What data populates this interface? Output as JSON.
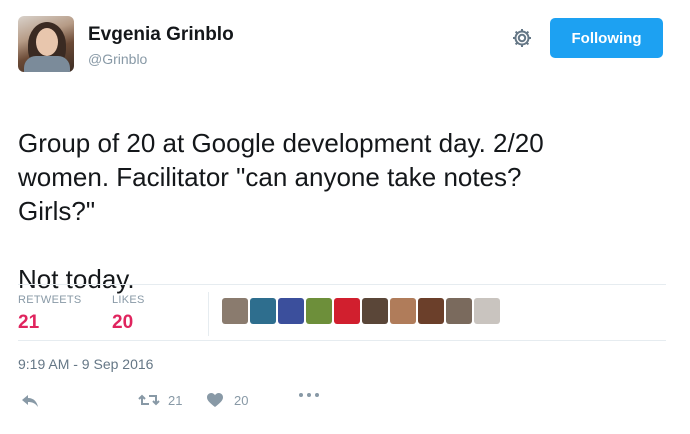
{
  "user": {
    "name": "Evgenia Grinblo",
    "handle": "@Grinblo"
  },
  "follow_button": {
    "label": "Following"
  },
  "tweet": {
    "line1": "Group of 20 at Google development day. 2/20\nwomen. Facilitator \"can anyone take notes?\nGirls?\"",
    "line2": "Not today."
  },
  "stats": {
    "retweets_label": "RETWEETS",
    "retweets": "21",
    "likes_label": "LIKES",
    "likes": "20"
  },
  "likers": [
    {
      "icon": "liker-avatar",
      "color": "#8a7b6e"
    },
    {
      "icon": "liker-avatar",
      "color": "#2e6e8e"
    },
    {
      "icon": "liker-avatar",
      "color": "#3b4f9c"
    },
    {
      "icon": "liker-avatar",
      "color": "#6d8f3a"
    },
    {
      "icon": "liker-avatar",
      "color": "#d11f2e"
    },
    {
      "icon": "liker-avatar",
      "color": "#5a4638"
    },
    {
      "icon": "liker-avatar",
      "color": "#b07c5a"
    },
    {
      "icon": "liker-avatar",
      "color": "#6b3f2a"
    },
    {
      "icon": "liker-avatar",
      "color": "#7a6a5d"
    },
    {
      "icon": "liker-avatar",
      "color": "#c9c4bf"
    }
  ],
  "timestamp": "9:19 AM - 9 Sep 2016",
  "actions": {
    "retweet_count": "21",
    "like_count": "20"
  },
  "colors": {
    "accent": "#1da1f2",
    "like": "#e0245e",
    "muted": "#8899a6"
  }
}
